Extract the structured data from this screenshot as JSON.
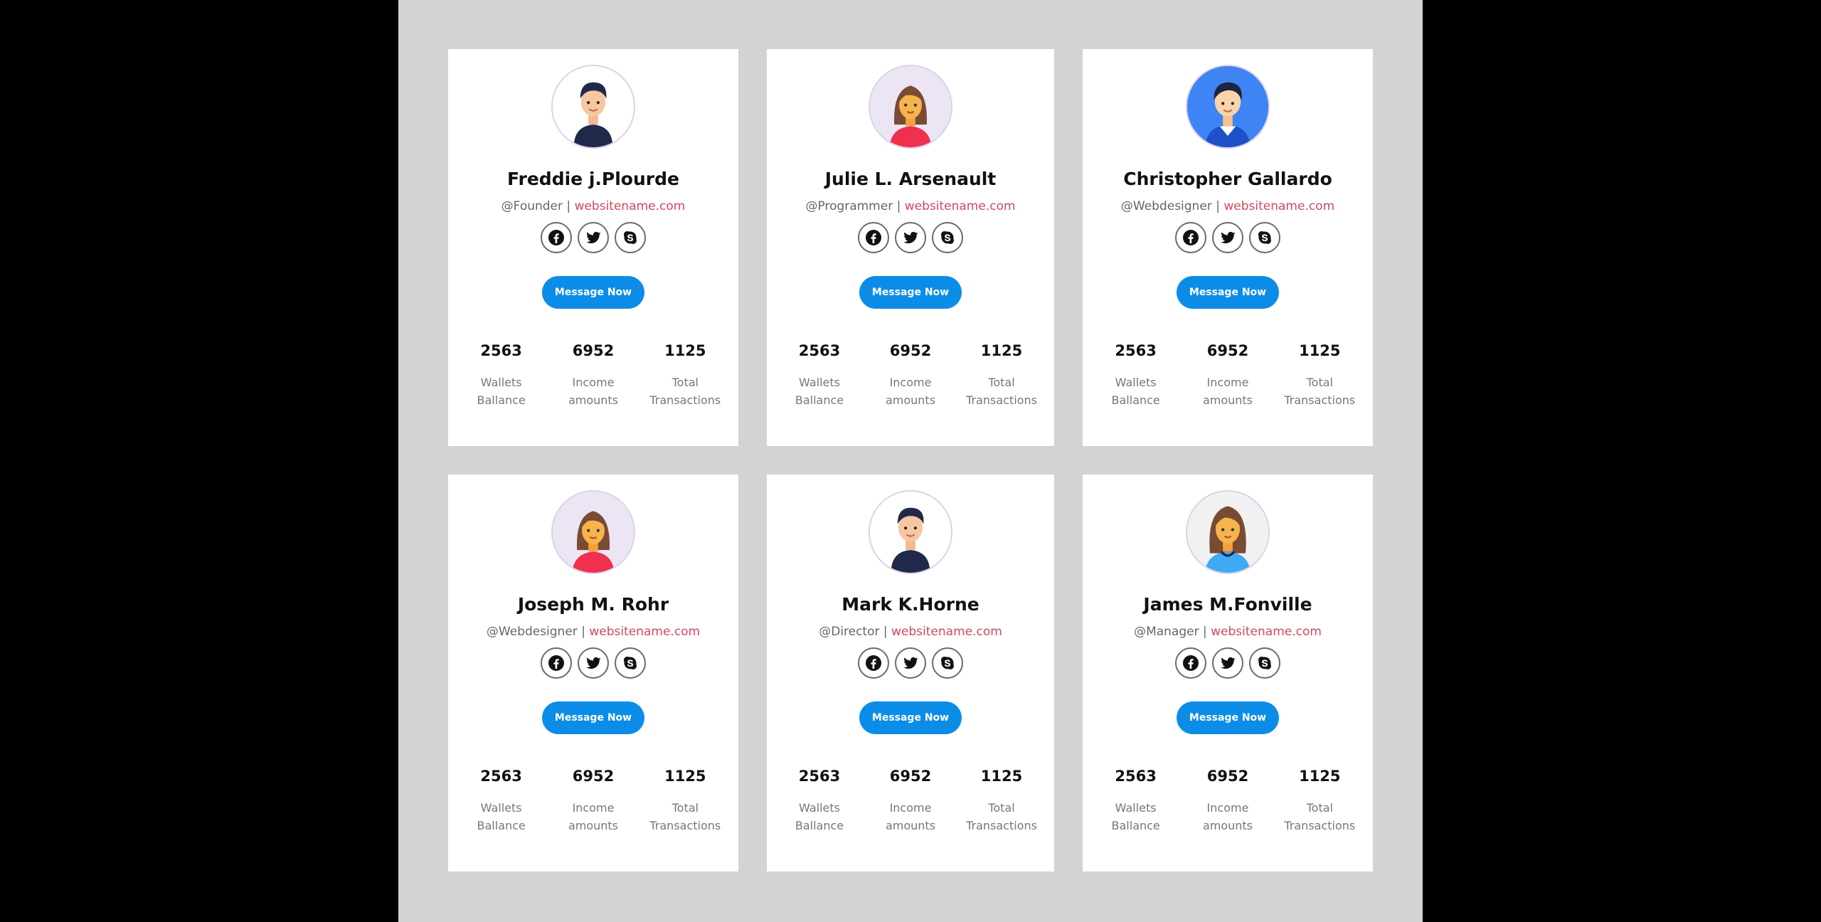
{
  "cards": [
    {
      "name": "Freddie j.Plourde",
      "handle": "@Founder",
      "separator": " | ",
      "site": "websitename.com",
      "avatar": "man-dark-hair-avatar",
      "button_label": "Message Now",
      "socials": [
        "facebook-icon",
        "twitter-icon",
        "skype-icon"
      ],
      "stats": [
        {
          "value": "2563",
          "label_1": "Wallets",
          "label_2": "Ballance"
        },
        {
          "value": "6952",
          "label_1": "Income",
          "label_2": "amounts"
        },
        {
          "value": "1125",
          "label_1": "Total",
          "label_2": "Transactions"
        }
      ]
    },
    {
      "name": "Julie L. Arsenault",
      "handle": "@Programmer",
      "separator": " | ",
      "site": "websitename.com",
      "avatar": "woman-red-shirt-avatar",
      "button_label": "Message Now",
      "socials": [
        "facebook-icon",
        "twitter-icon",
        "skype-icon"
      ],
      "stats": [
        {
          "value": "2563",
          "label_1": "Wallets",
          "label_2": "Ballance"
        },
        {
          "value": "6952",
          "label_1": "Income",
          "label_2": "amounts"
        },
        {
          "value": "1125",
          "label_1": "Total",
          "label_2": "Transactions"
        }
      ]
    },
    {
      "name": "Christopher Gallardo",
      "handle": "@Webdesigner",
      "separator": " | ",
      "site": "websitename.com",
      "avatar": "boy-blue-background-avatar",
      "button_label": "Message Now",
      "socials": [
        "facebook-icon",
        "twitter-icon",
        "skype-icon"
      ],
      "stats": [
        {
          "value": "2563",
          "label_1": "Wallets",
          "label_2": "Ballance"
        },
        {
          "value": "6952",
          "label_1": "Income",
          "label_2": "amounts"
        },
        {
          "value": "1125",
          "label_1": "Total",
          "label_2": "Transactions"
        }
      ]
    },
    {
      "name": "Joseph M. Rohr",
      "handle": "@Webdesigner",
      "separator": " | ",
      "site": "websitename.com",
      "avatar": "woman-red-shirt-avatar",
      "button_label": "Message Now",
      "socials": [
        "facebook-icon",
        "twitter-icon",
        "skype-icon"
      ],
      "stats": [
        {
          "value": "2563",
          "label_1": "Wallets",
          "label_2": "Ballance"
        },
        {
          "value": "6952",
          "label_1": "Income",
          "label_2": "amounts"
        },
        {
          "value": "1125",
          "label_1": "Total",
          "label_2": "Transactions"
        }
      ]
    },
    {
      "name": "Mark K.Horne",
      "handle": "@Director",
      "separator": " | ",
      "site": "websitename.com",
      "avatar": "man-dark-hair-avatar",
      "button_label": "Message Now",
      "socials": [
        "facebook-icon",
        "twitter-icon",
        "skype-icon"
      ],
      "stats": [
        {
          "value": "2563",
          "label_1": "Wallets",
          "label_2": "Ballance"
        },
        {
          "value": "6952",
          "label_1": "Income",
          "label_2": "amounts"
        },
        {
          "value": "1125",
          "label_1": "Total",
          "label_2": "Transactions"
        }
      ]
    },
    {
      "name": "James M.Fonville",
      "handle": "@Manager",
      "separator": " | ",
      "site": "websitename.com",
      "avatar": "woman-blue-shirt-avatar",
      "button_label": "Message Now",
      "socials": [
        "facebook-icon",
        "twitter-icon",
        "skype-icon"
      ],
      "stats": [
        {
          "value": "2563",
          "label_1": "Wallets",
          "label_2": "Ballance"
        },
        {
          "value": "6952",
          "label_1": "Income",
          "label_2": "amounts"
        },
        {
          "value": "1125",
          "label_1": "Total",
          "label_2": "Transactions"
        }
      ]
    }
  ],
  "colors": {
    "page_background": "#d3d3d3",
    "outer_background": "#000000",
    "button": "#0b8de7",
    "link": "#d4475e"
  }
}
